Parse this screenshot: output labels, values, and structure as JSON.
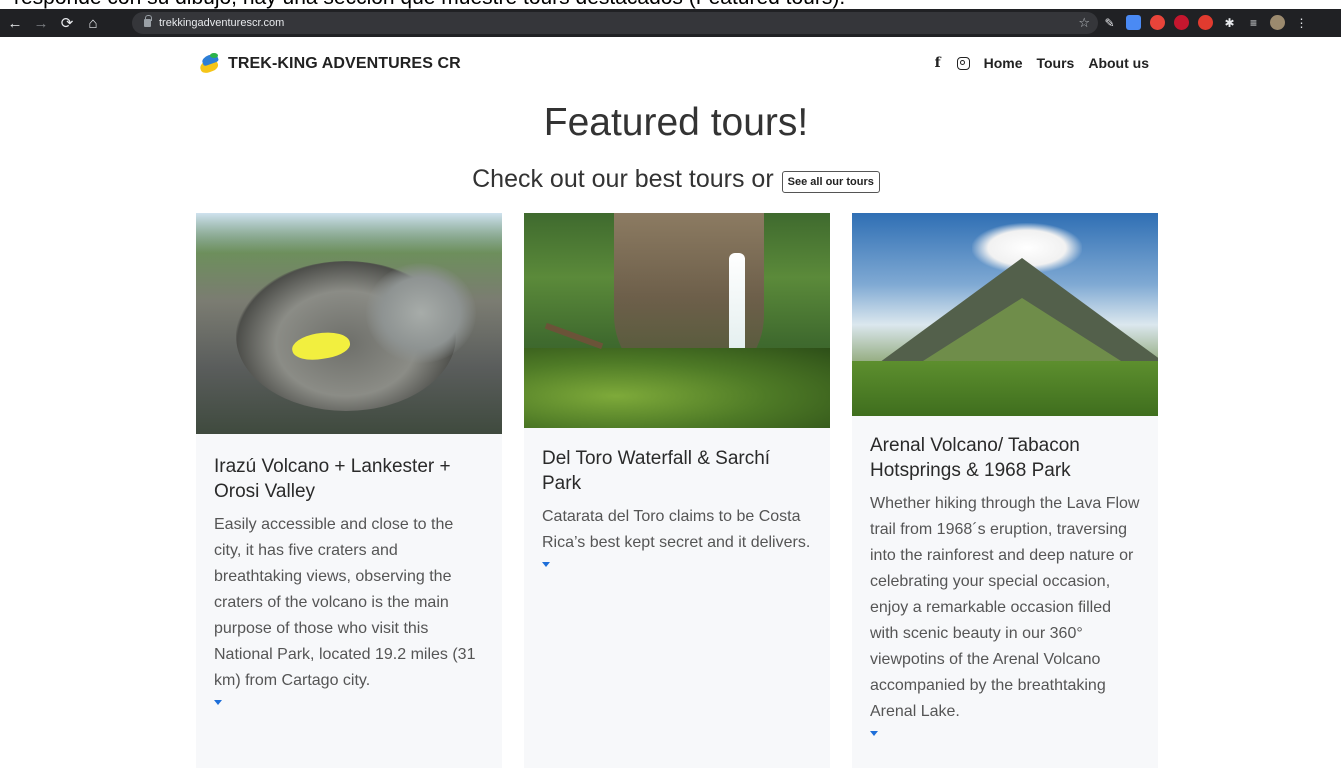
{
  "overlay_caption": "responde con su dibujo, hay una sección que muestre tours destacados (Featured tours).",
  "browser": {
    "url": "trekkingadventurescr.com"
  },
  "header": {
    "brand_name": "TREK-KING ADVENTURES CR",
    "nav": [
      {
        "label": "Home"
      },
      {
        "label": "Tours"
      },
      {
        "label": "About us"
      }
    ]
  },
  "hero": {
    "title": "Featured tours!",
    "subtitle": "Check out our best tours or",
    "see_all_label": "See all our tours"
  },
  "cards": [
    {
      "title": "Irazú Volcano + Lankester + Orosi Valley",
      "text": "Easily accessible and close to the city, it has five craters and breathtaking views, observing the craters of the volcano is the main purpose of those who visit this National Park, located 19.2 miles (31 km) from Cartago city."
    },
    {
      "title": "Del Toro Waterfall & Sarchí Park",
      "text": "Catarata del Toro claims to be Costa Rica’s best kept secret and it delivers."
    },
    {
      "title": "Arenal Volcano/ Tabacon Hotsprings & 1968 Park",
      "text": "Whether hiking through the Lava Flow trail from 1968´s eruption, traversing into the rainforest and deep nature or celebrating your special occasion, enjoy a remarkable occasion filled with scenic beauty in our 360° viewpotins of the Arenal Volcano accompanied by the breathtaking Arenal Lake."
    }
  ],
  "colors": {
    "accent": "#1e6fd9",
    "card_bg": "#f7f8fa",
    "chrome_bg": "#202124"
  }
}
